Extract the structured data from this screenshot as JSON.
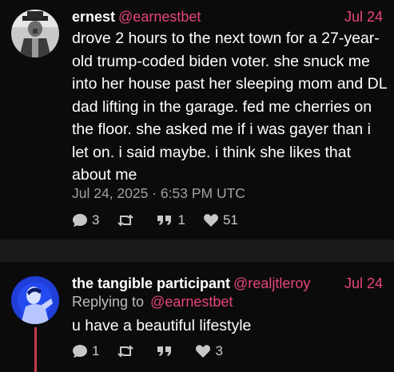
{
  "posts": [
    {
      "author_name": "ernest",
      "author_handle": "@earnestbet",
      "date": "Jul 24",
      "body": "drove 2 hours to the next town for a 27-year-old trump-coded biden voter. she snuck me into her house past her sleeping mom and DL dad lifting in the garage. fed me cherries on the floor. she asked me if i was gayer than i let on. i said maybe. i think she likes that about me",
      "timestamp": "Jul 24, 2025 · 6:53 PM UTC",
      "stats": {
        "replies": "3",
        "retweets": "",
        "quotes": "1",
        "likes": "51"
      }
    },
    {
      "author_name": "the tangible participant",
      "author_handle": "@realjtleroy",
      "date": "Jul 24",
      "replying_label": "Replying to",
      "replying_handle": "@earnestbet",
      "body": "u have a beautiful lifestyle",
      "stats": {
        "replies": "1",
        "retweets": "",
        "quotes": "",
        "likes": "3"
      }
    }
  ],
  "icons": {
    "reply": "comment-icon",
    "retweet": "retweet-icon",
    "quote": "quote-icon",
    "like": "heart-icon"
  },
  "colors": {
    "accent": "#e6457a",
    "background": "#0b0b0b",
    "separator": "#1a1a1a",
    "thread_line": "#c43c4c"
  }
}
